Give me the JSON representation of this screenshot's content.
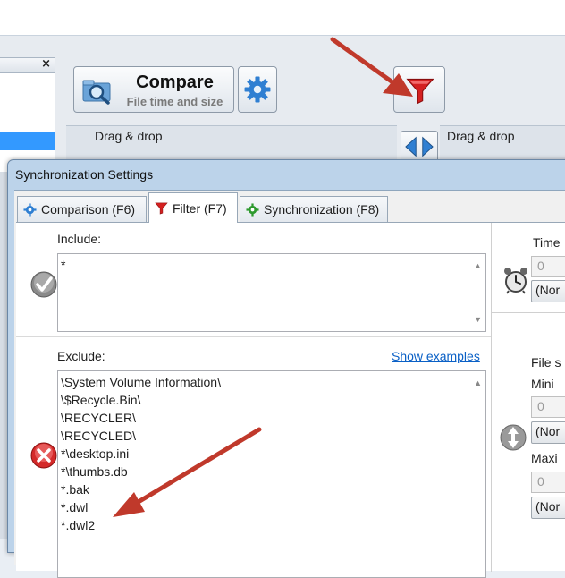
{
  "main_window": {
    "close_glyph": "×",
    "compare_button": {
      "title": "Compare",
      "subtitle": "File time and size"
    },
    "left_drop_label": "Drag & drop",
    "right_drop_label": "Drag & drop",
    "icons": {
      "compare": "magnifier-folder-icon",
      "settings": "gear-icon",
      "filter": "funnel-filter-icon",
      "swap": "swap-arrows-icon"
    }
  },
  "dialog": {
    "title": "Synchronization Settings",
    "tabs": [
      {
        "label": "Comparison (F6)",
        "icon": "gear-icon",
        "active": false
      },
      {
        "label": "Filter (F7)",
        "icon": "funnel-filter-icon",
        "active": true
      },
      {
        "label": "Synchronization (F8)",
        "icon": "sync-gear-icon",
        "active": false
      }
    ],
    "include": {
      "label": "Include:",
      "value": "*",
      "icon": "checkmark-icon"
    },
    "exclude": {
      "label": "Exclude:",
      "show_examples_link": "Show examples",
      "icon": "red-x-icon",
      "lines": [
        "\\System Volume Information\\",
        "\\$Recycle.Bin\\",
        "\\RECYCLER\\",
        "\\RECYCLED\\",
        "*\\desktop.ini",
        "*\\thumbs.db",
        "*.bak",
        "*.dwl",
        "*.dwl2"
      ]
    },
    "right_panel": {
      "time_label": "Time",
      "time_value": "0",
      "time_unit_select": "(Nor",
      "clock_icon": "alarm-clock-icon",
      "file_size_label": "File s",
      "minimum_label": "Mini",
      "minimum_value": "0",
      "minimum_unit_select": "(Nor",
      "maximum_label": "Maxi",
      "maximum_value": "0",
      "maximum_unit_select": "(Nor",
      "size_icon": "up-down-arrows-icon"
    }
  },
  "colors": {
    "annotation_arrow": "#c0392b",
    "dialog_frame": "#bcd3ea",
    "link": "#0a60c6"
  }
}
